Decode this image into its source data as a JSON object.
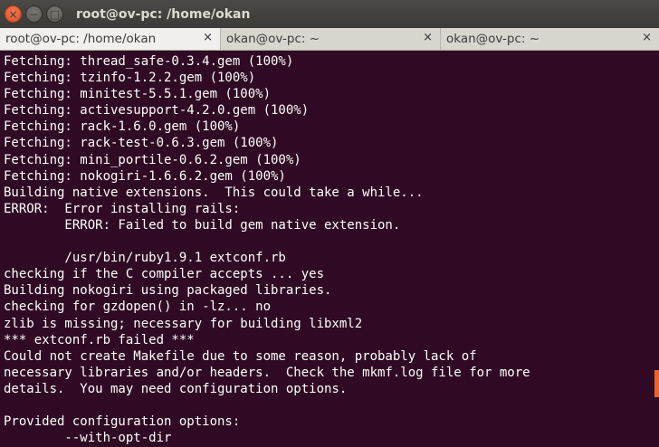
{
  "window": {
    "title": "root@ov-pc: /home/okan",
    "buttons": {
      "close": "×",
      "minimize": "−",
      "maximize": "□"
    }
  },
  "tabs": [
    {
      "label": "root@ov-pc: /home/okan",
      "close": "×",
      "active": true
    },
    {
      "label": "okan@ov-pc: ~",
      "close": "×",
      "active": false
    },
    {
      "label": "okan@ov-pc: ~",
      "close": "×",
      "active": false
    }
  ],
  "terminal": {
    "background": "#300a24",
    "foreground": "#ffffff",
    "lines": [
      "Fetching: thread_safe-0.3.4.gem (100%)",
      "Fetching: tzinfo-1.2.2.gem (100%)",
      "Fetching: minitest-5.5.1.gem (100%)",
      "Fetching: activesupport-4.2.0.gem (100%)",
      "Fetching: rack-1.6.0.gem (100%)",
      "Fetching: rack-test-0.6.3.gem (100%)",
      "Fetching: mini_portile-0.6.2.gem (100%)",
      "Fetching: nokogiri-1.6.6.2.gem (100%)",
      "Building native extensions.  This could take a while...",
      "ERROR:  Error installing rails:",
      "        ERROR: Failed to build gem native extension.",
      "",
      "        /usr/bin/ruby1.9.1 extconf.rb",
      "checking if the C compiler accepts ... yes",
      "Building nokogiri using packaged libraries.",
      "checking for gzdopen() in -lz... no",
      "zlib is missing; necessary for building libxml2",
      "*** extconf.rb failed ***",
      "Could not create Makefile due to some reason, probably lack of",
      "necessary libraries and/or headers.  Check the mkmf.log file for more",
      "details.  You may need configuration options.",
      "",
      "Provided configuration options:",
      "        --with-opt-dir"
    ]
  },
  "scrollbar": {
    "accent": "#e9652e"
  }
}
